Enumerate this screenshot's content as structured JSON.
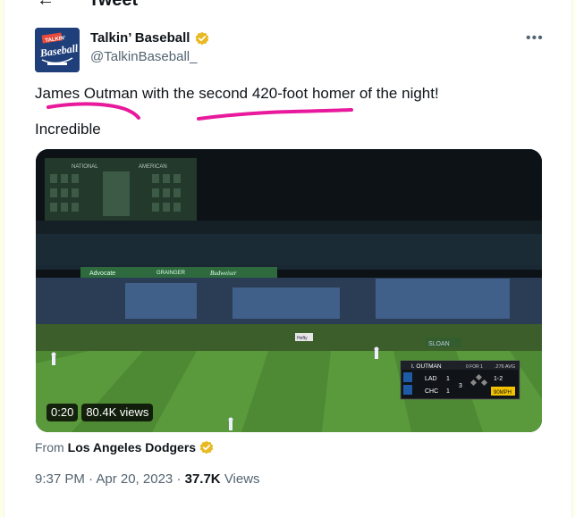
{
  "header": {
    "back_icon": "back-arrow-icon",
    "title": "Tweet"
  },
  "tweet": {
    "author": {
      "display_name": "Talkin’ Baseball",
      "handle": "@TalkinBaseball_",
      "avatar_text": "TALKIN' Baseball",
      "verified_color": "#e8b923"
    },
    "text_line_1": "James Outman with the second 420-foot homer of the night!",
    "text_line_2": "Incredible",
    "highlight_color": "#e8199c",
    "media": {
      "elapsed": "0:20",
      "views": "80.4K views",
      "scorebug": {
        "batter": "I. OUTMAN",
        "batter_stat": "0 FOR 1",
        "avg": ".276 AVG",
        "team1": "LAD",
        "score1": "1",
        "team2": "CHC",
        "score2": "1",
        "inning": "3",
        "count": "1-2",
        "pitch_speed": "90MPH"
      },
      "signage": {
        "scoreboard_left": "NATIONAL",
        "scoreboard_right": "AMERICAN",
        "sign_1": "Advocate",
        "sign_2": "GRAINGER",
        "sign_3": "Budweiser",
        "sign_4": "Hefty",
        "sign_5": "SLOAN"
      }
    },
    "from_label": "From",
    "from_account": "Los Angeles Dodgers",
    "timestamp": "9:37 PM · Apr 20, 2023",
    "separator": "·",
    "view_count": "37.7K",
    "views_label": "Views"
  }
}
